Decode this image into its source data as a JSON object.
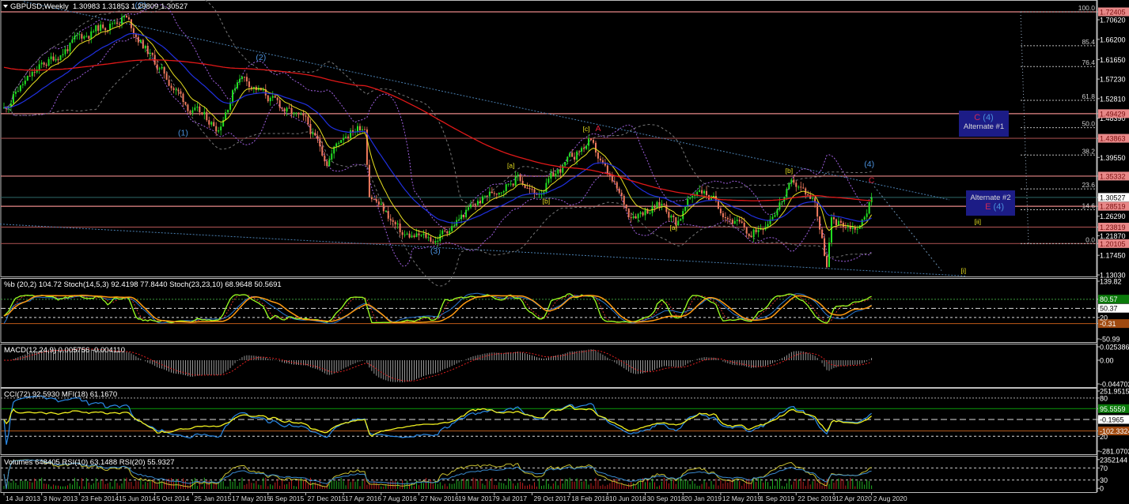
{
  "header": {
    "symbol_label": "GBPUSD,Weekly",
    "ohlc": "1.30983 1.31853 1.29809 1.30527"
  },
  "boxes": {
    "alt1": {
      "wave_letter": "C",
      "wave_num": "(4)",
      "label": "Alternate #1"
    },
    "alt2": {
      "label": "Alternate #2",
      "wave_letter": "E",
      "wave_num": "(4)"
    }
  },
  "indicators": {
    "bstoch_label": "%b (20,2) 104.72  Stoch(14,5,3) 92.4198 77.8440  Stoch(23,23,10) 68.9648 50.5691",
    "macd_label": "MACD(12,24,9) 0.005756 -0.004110",
    "cci_label": "CCI(72) 92.5930  MFI(18) 61.1670",
    "vol_label": "Volumes 648405  RSI(10) 63.1488  RSI(20) 55.9327"
  },
  "colors": {
    "up": "#22e022",
    "down": "#f07a5e",
    "level": "#e88888",
    "level_dark": "#9a4a4a",
    "current": "#2e6a6a",
    "ma_fast": "#e8e020",
    "ma_mid": "#2030e0",
    "ma_slow": "#e01818"
  },
  "chart_data": {
    "type": "candlestick",
    "symbol": "GBPUSD",
    "timeframe": "Weekly",
    "last": {
      "open": 1.30983,
      "high": 1.31853,
      "low": 1.29809,
      "close": 1.30527
    },
    "start_date": "2013-07-14",
    "waypoints": [
      {
        "date": "2013-07-14",
        "close": 1.505
      },
      {
        "date": "2013-08-25",
        "close": 1.55
      },
      {
        "date": "2013-11-03",
        "close": 1.6
      },
      {
        "date": "2014-02-23",
        "close": 1.665
      },
      {
        "date": "2014-07-06",
        "close": 1.715
      },
      {
        "date": "2014-10-05",
        "close": 1.61
      },
      {
        "date": "2015-01-25",
        "close": 1.5
      },
      {
        "date": "2015-04-12",
        "close": 1.465
      },
      {
        "date": "2015-06-14",
        "close": 1.585
      },
      {
        "date": "2015-09-06",
        "close": 1.53
      },
      {
        "date": "2015-12-27",
        "close": 1.47
      },
      {
        "date": "2016-02-28",
        "close": 1.39
      },
      {
        "date": "2016-04-17",
        "close": 1.45
      },
      {
        "date": "2016-06-19",
        "close": 1.47
      },
      {
        "date": "2016-07-03",
        "close": 1.32
      },
      {
        "date": "2016-10-09",
        "close": 1.22
      },
      {
        "date": "2017-01-15",
        "close": 1.21
      },
      {
        "date": "2017-05-14",
        "close": 1.29
      },
      {
        "date": "2017-09-17",
        "close": 1.355
      },
      {
        "date": "2017-11-05",
        "close": 1.31
      },
      {
        "date": "2018-04-15",
        "close": 1.43
      },
      {
        "date": "2018-08-12",
        "close": 1.27
      },
      {
        "date": "2018-11-25",
        "close": 1.29
      },
      {
        "date": "2018-12-30",
        "close": 1.25
      },
      {
        "date": "2019-03-10",
        "close": 1.33
      },
      {
        "date": "2019-08-11",
        "close": 1.215
      },
      {
        "date": "2019-12-15",
        "close": 1.335
      },
      {
        "date": "2020-02-16",
        "close": 1.3
      },
      {
        "date": "2020-03-22",
        "close": 1.15
      },
      {
        "date": "2020-04-05",
        "close": 1.25
      },
      {
        "date": "2020-06-28",
        "close": 1.24
      },
      {
        "date": "2020-08-02",
        "close": 1.30527
      }
    ],
    "price_axis": {
      "max": 1.72405,
      "min": 1.1303,
      "ticks": [
        "1.70620",
        "1.66200",
        "1.61650",
        "1.57230",
        "1.52810",
        "1.48390",
        "1.39550",
        "1.26290",
        "1.21870",
        "1.17450",
        "1.13030"
      ]
    },
    "levels": [
      {
        "price": "1.72405",
        "style": "level"
      },
      {
        "price": "1.49429",
        "style": "level"
      },
      {
        "price": "1.43863",
        "style": "level_dark"
      },
      {
        "price": "1.35332",
        "style": "level"
      },
      {
        "price": "1.28519",
        "style": "level"
      },
      {
        "price": "1.23819",
        "style": "level_dark"
      },
      {
        "price": "1.20105",
        "style": "level_dark"
      }
    ],
    "current_price": "1.30527",
    "fibonacci": {
      "from": 1.20105,
      "to": 1.72405,
      "levels": [
        "100.0",
        "85.4",
        "76.4",
        "61.8",
        "50.0",
        "38.2",
        "23.6",
        "14.6",
        "0.0"
      ]
    },
    "wave_labels": [
      {
        "text": "(C)",
        "date": "2014-08-24",
        "price": 1.733,
        "color": "#4a90dc"
      },
      {
        "text": "(1)",
        "date": "2014-12-28",
        "price": 1.445,
        "color": "#4a90dc"
      },
      {
        "text": "(2)",
        "date": "2015-08-16",
        "price": 1.615,
        "color": "#4a90dc"
      },
      {
        "text": "(3)",
        "date": "2017-01-15",
        "price": 1.178,
        "color": "#4a90dc"
      },
      {
        "text": "[a]",
        "date": "2017-08-27",
        "price": 1.372,
        "color": "#e8e020"
      },
      {
        "text": "[b]",
        "date": "2017-12-10",
        "price": 1.292,
        "color": "#e8e020"
      },
      {
        "text": "[c]",
        "date": "2018-04-08",
        "price": 1.455,
        "color": "#e8e020"
      },
      {
        "text": "A",
        "date": "2018-05-13",
        "price": 1.455,
        "color": "#e0203a"
      },
      {
        "text": "[a]",
        "date": "2018-12-23",
        "price": 1.232,
        "color": "#e8e020"
      },
      {
        "text": "[b]",
        "date": "2019-12-01",
        "price": 1.36,
        "color": "#e8e020"
      },
      {
        "text": "(4)",
        "date": "2020-07-26",
        "price": 1.375,
        "color": "#4a90dc"
      },
      {
        "text": "C",
        "date": "2020-08-02",
        "price": 1.338,
        "color": "#e0203a"
      },
      {
        "text": "[ii]",
        "date": "2021-06-13",
        "price": 1.245,
        "color": "#e8e020"
      },
      {
        "text": "[i]",
        "date": "2021-05-02",
        "price": 1.135,
        "color": "#e8e020"
      }
    ],
    "x_ticks": [
      "14 Jul 2013",
      "3 Nov 2013",
      "23 Feb 2014",
      "15 Jun 2014",
      "5 Oct 2014",
      "25 Jan 2015",
      "17 May 2015",
      "6 Sep 2015",
      "27 Dec 2015",
      "17 Apr 2016",
      "7 Aug 2016",
      "27 Nov 2016",
      "19 Mar 2017",
      "9 Jul 2017",
      "29 Oct 2017",
      "18 Feb 2018",
      "10 Jun 2018",
      "30 Sep 2018",
      "20 Jan 2019",
      "12 May 2019",
      "1 Sep 2019",
      "22 Dec 2019",
      "12 Apr 2020",
      "2 Aug 2020"
    ],
    "panels": [
      {
        "name": "bstoch",
        "range": [
          -50.99,
          139.82
        ],
        "labels": [
          {
            "value": 139.82,
            "text": "139.82",
            "style": "plain"
          },
          {
            "value": 80,
            "text": "80",
            "style": "plain"
          },
          {
            "value": 80.57,
            "text": "80.57",
            "style": "green"
          },
          {
            "value": 50.37,
            "text": "50.37",
            "style": "white"
          },
          {
            "value": -0.31,
            "text": "-0.31",
            "style": "orange"
          },
          {
            "value": 20,
            "text": "20",
            "style": "plain"
          },
          {
            "value": -50.99,
            "text": "-50.99",
            "style": "plain"
          }
        ]
      },
      {
        "name": "macd",
        "range": [
          -0.044702,
          0.025386
        ],
        "labels": [
          {
            "value": 0.025386,
            "text": "0.025386",
            "style": "plain"
          },
          {
            "value": 0,
            "text": "0.00",
            "style": "plain"
          },
          {
            "value": -0.044702,
            "text": "-0.044702",
            "style": "plain"
          }
        ]
      },
      {
        "name": "cci",
        "range": [
          -281.0702,
          251.9515
        ],
        "labels": [
          {
            "value": 251.9515,
            "text": "251.9515",
            "style": "plain"
          },
          {
            "value": 190,
            "text": "80",
            "style": "plain"
          },
          {
            "value": 95.5559,
            "text": "95.5559",
            "style": "green"
          },
          {
            "value": -0.1965,
            "text": "-0.1965",
            "style": "white"
          },
          {
            "value": -102.3324,
            "text": "-102.3324",
            "style": "orange"
          },
          {
            "value": -150,
            "text": "20",
            "style": "plain"
          },
          {
            "value": -281.0702,
            "text": "-281.0702",
            "style": "plain"
          }
        ]
      },
      {
        "name": "volume",
        "range": [
          0,
          100
        ],
        "labels": [
          {
            "value": 98,
            "text": "2352144",
            "style": "plain"
          },
          {
            "value": 70,
            "text": "70",
            "style": "plain"
          },
          {
            "value": 30,
            "text": "30",
            "style": "plain"
          },
          {
            "value": 2,
            "text": "0",
            "style": "plain"
          }
        ]
      }
    ]
  }
}
